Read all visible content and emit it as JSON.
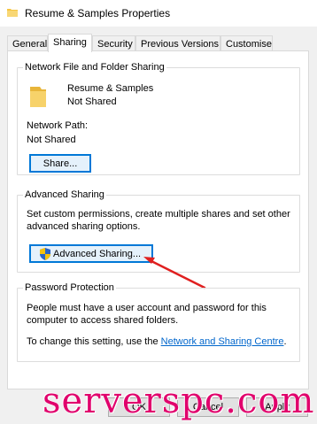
{
  "window": {
    "title": "Resume & Samples Properties"
  },
  "tabs": [
    "General",
    "Sharing",
    "Security",
    "Previous Versions",
    "Customise"
  ],
  "active_tab": "Sharing",
  "network_sharing": {
    "group_title": "Network File and Folder Sharing",
    "folder_name": "Resume & Samples",
    "share_status": "Not Shared",
    "network_path_label": "Network Path:",
    "network_path_value": "Not Shared",
    "share_button": "Share..."
  },
  "advanced_sharing": {
    "group_title": "Advanced Sharing",
    "description_line1": "Set custom permissions, create multiple shares and set other",
    "description_line2": "advanced sharing options.",
    "button": "Advanced Sharing..."
  },
  "password_protection": {
    "group_title": "Password Protection",
    "line1": "People must have a user account and password for this",
    "line2": "computer to access shared folders.",
    "change_prefix": "To change this setting, use the ",
    "link": "Network and Sharing Centre",
    "change_suffix": "."
  },
  "footer": {
    "ok": "OK",
    "cancel": "Cancel",
    "apply": "Apply"
  },
  "watermark": "serverspc.com",
  "colors": {
    "accent": "#0078d7",
    "link": "#0066cc",
    "arrow": "#e02020",
    "watermark": "#e0006c",
    "folder": "#f5c542"
  }
}
